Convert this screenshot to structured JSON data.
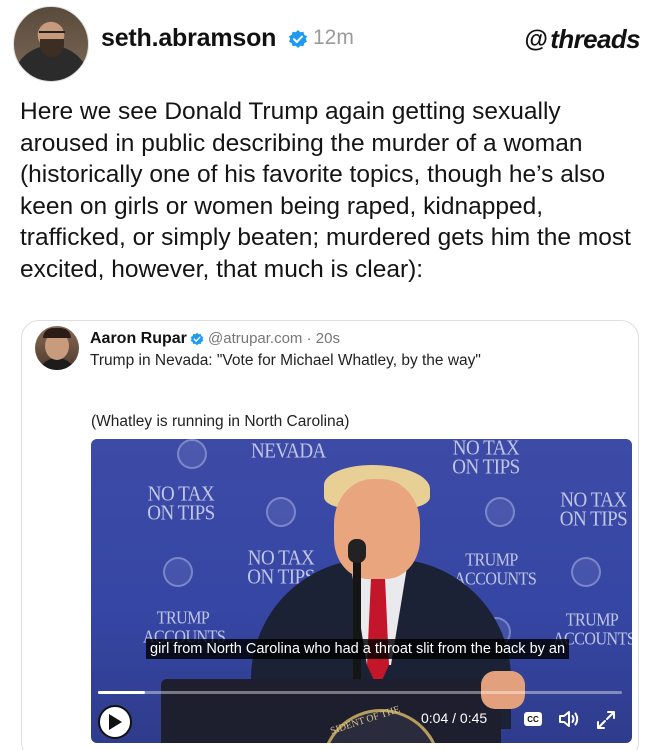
{
  "post": {
    "username": "seth.abramson",
    "time": "12m",
    "app_brand": "threads",
    "text": "Here we see Donald Trump again getting sexually aroused in public describing the murder of a woman (historically one of his favorite topics, though he’s also keen on girls or women being raped, kidnapped, trafficked, or simply beaten; murdered gets him the most excited, however, that much is clear):",
    "accent_color": "#1d9bf0"
  },
  "quote": {
    "name": "Aaron Rupar",
    "handle": "@atrupar.com · 20s",
    "line1": "Trump in Nevada: \"Vote for Michael Whatley, by the way\"",
    "line2": "(Whatley is running in North Carolina)"
  },
  "video": {
    "backdrop": {
      "nevada": "NEVADA",
      "no_tax_1": "NO TAX ON TIPS",
      "no_tax_2": "NO TAX ON TIPS",
      "no_tax_3": "NO TAX ON TIPS",
      "no_tax_4": "NO TAX ON TIPS",
      "trump_accounts_1": "TRUMP ACCOUNTS",
      "trump_accounts_2": "TRUMP ACCOUNTS",
      "trump_accounts_3": "TRUMP ACCOUNTS",
      "seal_text": "SIDENT OF THE"
    },
    "caption": "girl from North Carolina who had a throat slit from the back by an",
    "current_time": "0:04",
    "duration": "0:45",
    "time_readout": "0:04 / 0:45",
    "progress_fraction": 0.09,
    "cc_label": "CC",
    "icons": [
      "play-icon",
      "cc-icon",
      "volume-icon",
      "fullscreen-icon"
    ]
  }
}
